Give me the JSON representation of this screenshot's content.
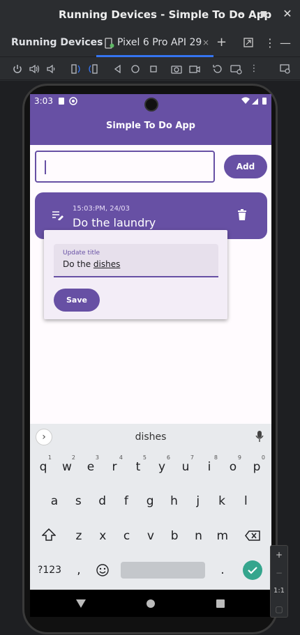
{
  "window": {
    "title": "Running Devices - Simple To Do App",
    "minimize": "–",
    "maximize": "■",
    "close": "✕"
  },
  "toolwindow": {
    "label": "Running Devices",
    "tab": "Pixel 6 Pro API 29",
    "tab_close": "×",
    "add": "+",
    "more": "⋮",
    "hide": "—"
  },
  "device": {
    "status_time": "3:03",
    "app_title": "Simple To Do App",
    "input_value": "",
    "add_label": "Add",
    "todo": {
      "time": "15:03:PM, 24/03",
      "text": "Do the laundry"
    },
    "dialog": {
      "field_label": "Update title",
      "field_value_prefix": "Do the ",
      "field_value_word": "dishes",
      "save_label": "Save"
    }
  },
  "keyboard": {
    "suggestion": "dishes",
    "row1": [
      "q",
      "w",
      "e",
      "r",
      "t",
      "y",
      "u",
      "i",
      "o",
      "p"
    ],
    "row1_hints": [
      "1",
      "2",
      "3",
      "4",
      "5",
      "6",
      "7",
      "8",
      "9",
      "0"
    ],
    "row2": [
      "a",
      "s",
      "d",
      "f",
      "g",
      "h",
      "j",
      "k",
      "l"
    ],
    "row3": [
      "z",
      "x",
      "c",
      "v",
      "b",
      "n",
      "m"
    ],
    "symbols": "?123",
    "comma": ",",
    "period": "."
  },
  "zoom_panel": {
    "zoom_in": "+",
    "zoom_out": "−",
    "actual": "1:1"
  }
}
